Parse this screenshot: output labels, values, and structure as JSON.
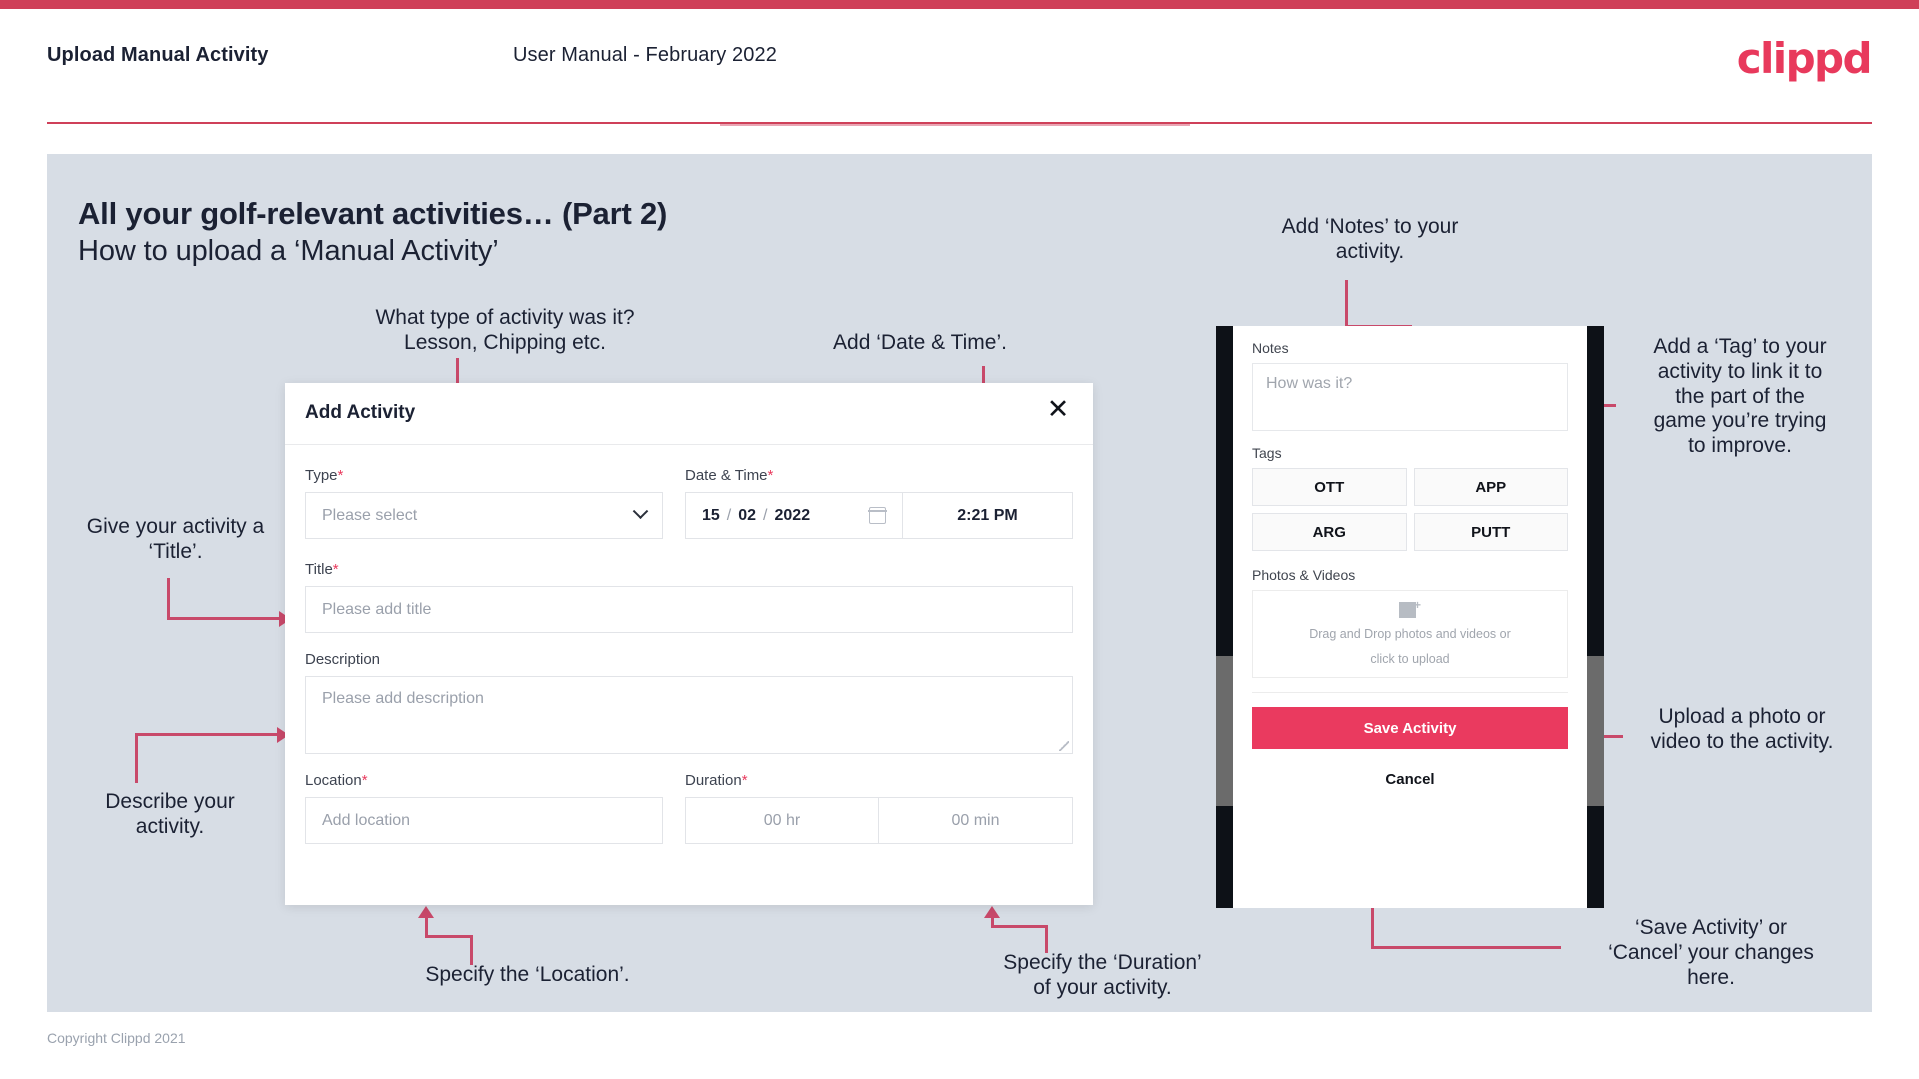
{
  "header": {
    "title": "Upload Manual Activity",
    "subtitle": "User Manual - February 2022",
    "logo": "clippd"
  },
  "slide": {
    "title": "All your golf-relevant activities… (Part 2)",
    "subtitle": "How to upload a ‘Manual Activity’"
  },
  "footer": {
    "copyright": "Copyright Clippd 2021"
  },
  "dialog": {
    "title": "Add Activity",
    "close_icon": "✕",
    "fields": {
      "type": {
        "label": "Type",
        "required": "*",
        "placeholder": "Please select"
      },
      "datetime": {
        "label": "Date & Time",
        "required": "*",
        "day": "15",
        "month": "02",
        "year": "2022",
        "sep": "/",
        "time": "2:21 PM"
      },
      "title": {
        "label": "Title",
        "required": "*",
        "placeholder": "Please add title"
      },
      "description": {
        "label": "Description",
        "placeholder": "Please add description"
      },
      "location": {
        "label": "Location",
        "required": "*",
        "placeholder": "Add location"
      },
      "duration": {
        "label": "Duration",
        "required": "*",
        "hours": "00 hr",
        "minutes": "00 min"
      }
    }
  },
  "phone": {
    "notes": {
      "label": "Notes",
      "placeholder": "How was it?"
    },
    "tags": {
      "label": "Tags",
      "items": [
        "OTT",
        "APP",
        "ARG",
        "PUTT"
      ]
    },
    "photos": {
      "label": "Photos & Videos",
      "dropzone_line1": "Drag and Drop photos and videos or",
      "dropzone_line2": "click to upload"
    },
    "save_label": "Save Activity",
    "cancel_label": "Cancel"
  },
  "annotations": {
    "type": "What type of activity was it?\nLesson, Chipping etc.",
    "datetime": "Add ‘Date & Time’.",
    "title": "Give your activity a\n‘Title’.",
    "description": "Describe your\nactivity.",
    "location": "Specify the ‘Location’.",
    "duration": "Specify the ‘Duration’\nof your activity.",
    "notes": "Add ‘Notes’ to your\nactivity.",
    "tags": "Add a ‘Tag’ to your\nactivity to link it to\nthe part of the\ngame you’re trying\nto improve.",
    "photos": "Upload a photo or\nvideo to the activity.",
    "save": "‘Save Activity’ or\n‘Cancel’ your changes\nhere."
  },
  "colors": {
    "brand": "#e8395c",
    "accent_line": "#c8496a",
    "slide_bg": "#d7dde5",
    "text": "#1b2133"
  }
}
